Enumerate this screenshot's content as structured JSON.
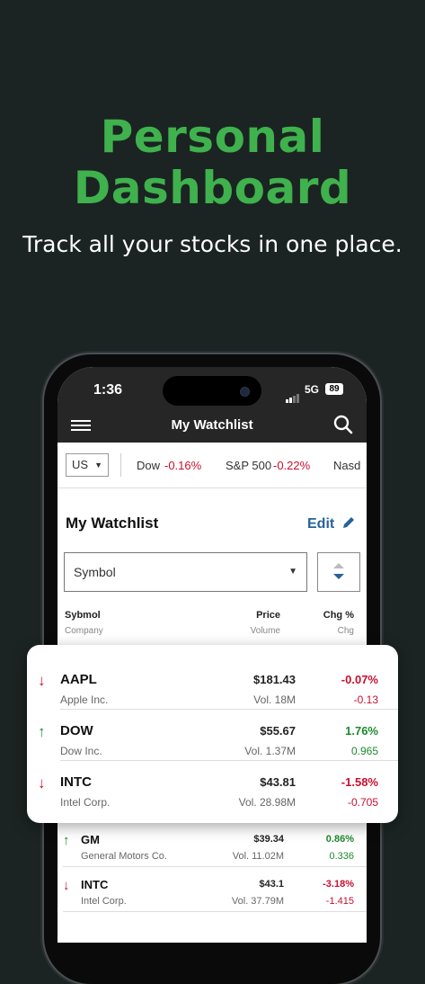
{
  "hero": {
    "title_line1": "Personal",
    "title_line2": "Dashboard",
    "subtitle": "Track all your stocks in one place."
  },
  "status_bar": {
    "time": "1:36",
    "network": "5G",
    "battery": "89"
  },
  "nav": {
    "title": "My Watchlist",
    "menu_icon": "hamburger-icon",
    "search_icon": "search-icon"
  },
  "ticker": {
    "market": "US",
    "items": [
      {
        "name": "Dow",
        "change": "-0.16%"
      },
      {
        "name": "S&P 500",
        "change": "-0.22%"
      },
      {
        "name": "Nasd",
        "change": ""
      }
    ]
  },
  "watchlist": {
    "title": "My Watchlist",
    "edit_label": "Edit",
    "sort_select": "Symbol",
    "columns": {
      "symbol": "Sybmol",
      "company": "Company",
      "price": "Price",
      "volume": "Volume",
      "chg_pct": "Chg %",
      "chg": "Chg"
    }
  },
  "card_rows": [
    {
      "symbol": "AAPL",
      "company": "Apple Inc.",
      "price": "$181.43",
      "volume": "Vol. 18M",
      "chg_pct": "-0.07%",
      "chg": "-0.13",
      "direction": "down"
    },
    {
      "symbol": "DOW",
      "company": "Dow Inc.",
      "price": "$55.67",
      "volume": "Vol. 1.37M",
      "chg_pct": "1.76%",
      "chg": "0.965",
      "direction": "up"
    },
    {
      "symbol": "INTC",
      "company": "Intel Corp.",
      "price": "$43.81",
      "volume": "Vol. 28.98M",
      "chg_pct": "-1.58%",
      "chg": "-0.705",
      "direction": "down"
    }
  ],
  "bg_rows": [
    {
      "symbol": "GM",
      "company": "General Motors Co.",
      "price": "$39.34",
      "volume": "Vol. 11.02M",
      "chg_pct": "0.86%",
      "chg": "0.336",
      "direction": "up"
    },
    {
      "symbol": "INTC",
      "company": "Intel Corp.",
      "price": "$43.1",
      "volume": "Vol. 37.79M",
      "chg_pct": "-3.18%",
      "chg": "-1.415",
      "direction": "down"
    }
  ],
  "colors": {
    "accent_green": "#3fb14d",
    "negative": "#c8102e",
    "positive": "#1c8a2e",
    "link": "#27629c",
    "background": "#1b2422"
  }
}
